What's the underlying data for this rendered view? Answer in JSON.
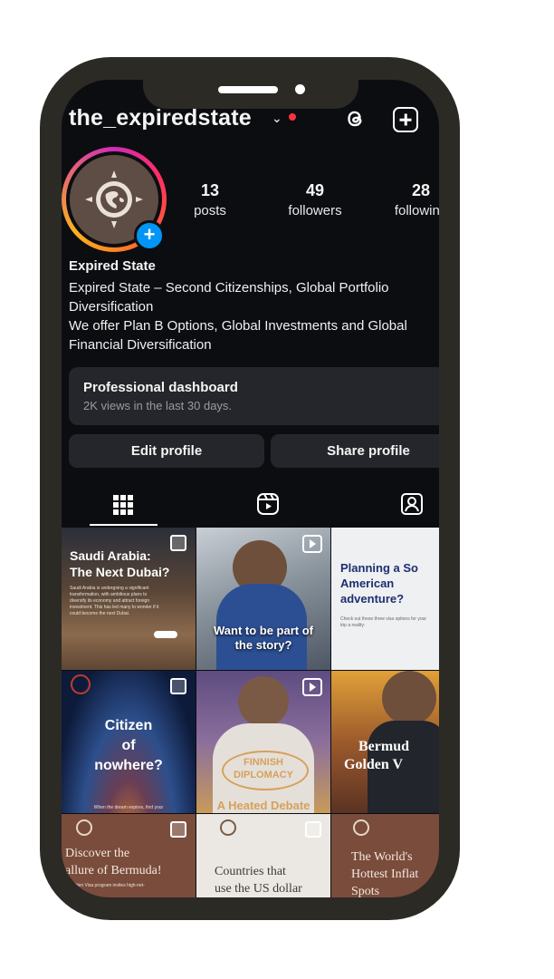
{
  "profile": {
    "username": "the_expiredstate",
    "display_name": "Expired State",
    "bio_lines": [
      "Expired State – Second Citizenships, Global Portfolio",
      "Diversification",
      "We offer Plan B Options, Global Investments and Global",
      "Financial Diversification"
    ],
    "stats": [
      {
        "value": "13",
        "label": "posts"
      },
      {
        "value": "49",
        "label": "followers"
      },
      {
        "value": "28",
        "label": "following"
      }
    ]
  },
  "dashboard": {
    "title": "Professional dashboard",
    "subtitle": "2K views in the last 30 days."
  },
  "buttons": {
    "edit": "Edit profile",
    "share": "Share profile"
  },
  "header_icons": [
    "chevron-down-icon",
    "notification-dot",
    "threads-icon",
    "new-post-icon"
  ],
  "tabs": [
    "grid-tab",
    "reels-tab",
    "tagged-tab"
  ],
  "posts": [
    {
      "title_1": "Saudi Arabia:",
      "title_2": "The Next Dubai?",
      "body": "Saudi Arabia is undergoing a significant transformation, with ambitious plans to diversify its economy and attract foreign investment. This has led many to wonder if it could become the next Dubai.",
      "badge": "carousel-icon"
    },
    {
      "title_1": "Want to be part of",
      "title_2": "the story?",
      "badge": "reel-icon"
    },
    {
      "title_1": "Planning a So",
      "title_2": "American",
      "title_3": "adventure?",
      "body": "Check out these three visa options for your trip a reality:"
    },
    {
      "title_1": "Citizen",
      "title_2": "of",
      "title_3": "nowhere?",
      "body": "When the dream expires, find your",
      "badge": "carousel-icon"
    },
    {
      "title_1": "FINNISH",
      "title_2": "DIPLOMACY",
      "title_3": "A Heated Debate",
      "badge": "reel-icon"
    },
    {
      "title_1": "Bermud",
      "title_2": "Golden V"
    },
    {
      "title_1": "Discover the",
      "title_2": "allure of Bermuda!",
      "body": "Golden Visa program invites high-net-",
      "badge": "carousel-icon"
    },
    {
      "title_1": "Countries that",
      "title_2": "use the US dollar",
      "badge": "carousel-icon"
    },
    {
      "title_1": "The World's",
      "title_2": "Hottest Inflat",
      "title_3": "Spots"
    }
  ],
  "colors": {
    "screen_bg": "#0c0d11",
    "card_bg": "#25262b",
    "accent_blue": "#0095f6",
    "notification_red": "#ff3040",
    "phone_frame": "#2b2a24"
  }
}
